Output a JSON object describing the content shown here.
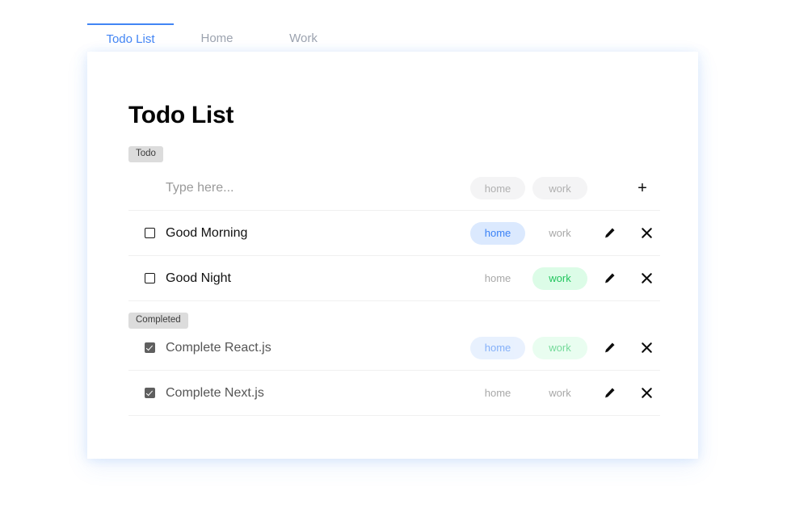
{
  "tabs": [
    {
      "label": "Todo List",
      "active": true
    },
    {
      "label": "Home",
      "active": false
    },
    {
      "label": "Work",
      "active": false
    }
  ],
  "page": {
    "title": "Todo List"
  },
  "sections": {
    "todo_badge": "Todo",
    "completed_badge": "Completed"
  },
  "add_row": {
    "placeholder": "Type here...",
    "value": "",
    "tags": [
      {
        "label": "home",
        "state": "neutral"
      },
      {
        "label": "work",
        "state": "neutral"
      }
    ],
    "add_label": "+"
  },
  "todo_items": [
    {
      "text": "Good Morning",
      "checked": false,
      "tags": [
        {
          "label": "home",
          "state": "home-on"
        },
        {
          "label": "work",
          "state": "off"
        }
      ]
    },
    {
      "text": "Good Night",
      "checked": false,
      "tags": [
        {
          "label": "home",
          "state": "off"
        },
        {
          "label": "work",
          "state": "work-on"
        }
      ]
    }
  ],
  "completed_items": [
    {
      "text": "Complete React.js",
      "checked": true,
      "tags": [
        {
          "label": "home",
          "state": "home-on dim"
        },
        {
          "label": "work",
          "state": "work-on dim"
        }
      ]
    },
    {
      "text": "Complete Next.js",
      "checked": true,
      "tags": [
        {
          "label": "home",
          "state": "off"
        },
        {
          "label": "work",
          "state": "off"
        }
      ]
    }
  ],
  "icons": {
    "edit": "pencil-icon",
    "delete": "close-icon"
  },
  "colors": {
    "accent": "#4285f4",
    "home_bg": "#dbe9fe",
    "home_fg": "#3b82f6",
    "work_bg": "#dcfce7",
    "work_fg": "#22c55e",
    "badge_bg": "#dcdcdc"
  }
}
